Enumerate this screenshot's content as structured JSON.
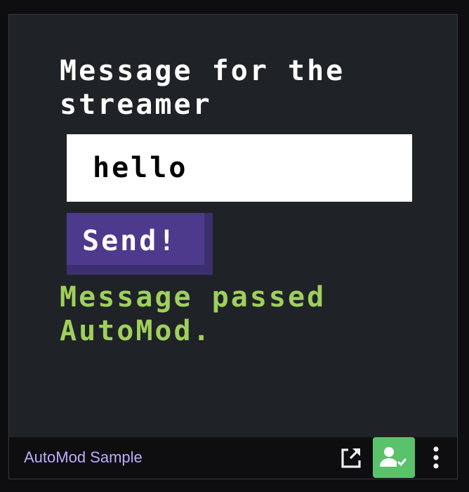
{
  "main": {
    "heading": "Message for the streamer",
    "input_value": "hello",
    "send_label": "Send!",
    "status_text": "Message passed AutoMod."
  },
  "footer": {
    "extension_name": "AutoMod Sample",
    "icons": [
      "popout-icon",
      "manage-access-icon",
      "more-options-icon"
    ]
  },
  "colors": {
    "panel_bg": "#1f2327",
    "send_button": "#4d3a8c",
    "status_text": "#9fcf5d",
    "extension_name": "#bfabff",
    "manage_access_bg": "#5ac26b"
  }
}
